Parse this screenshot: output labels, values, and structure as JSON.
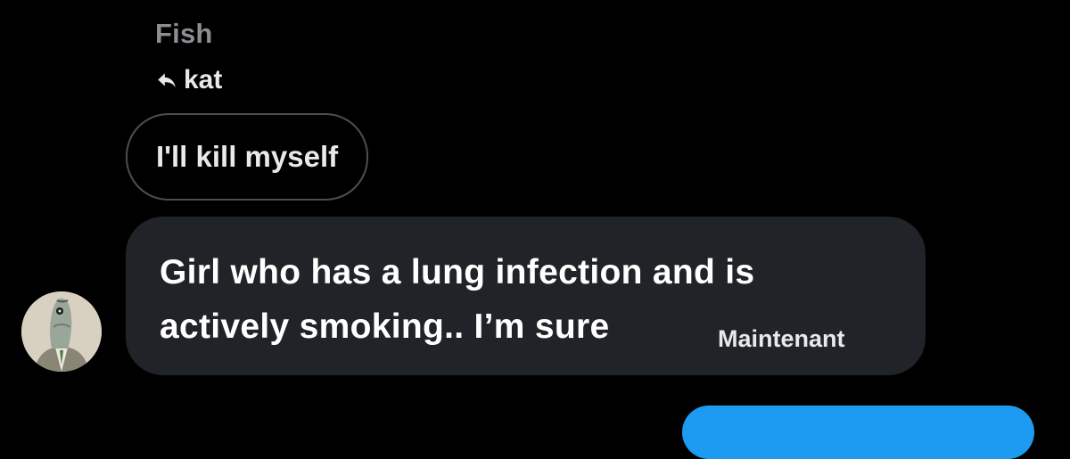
{
  "conversation": {
    "sender_name": "Fish",
    "reply_to": {
      "icon": "reply-arrow-icon",
      "name": "kat"
    },
    "quoted_message": "I'll kill myself",
    "message": {
      "text": "Girl who has a lung infection and is actively smoking.. I’m sure",
      "timestamp": "Maintenant"
    },
    "avatar": "fish-avatar-image"
  },
  "colors": {
    "background": "#000000",
    "incoming_bubble": "#202327",
    "outgoing_bubble": "#1d9bf0",
    "muted_text": "#8b8e92",
    "quoted_border": "#4b4f53"
  }
}
